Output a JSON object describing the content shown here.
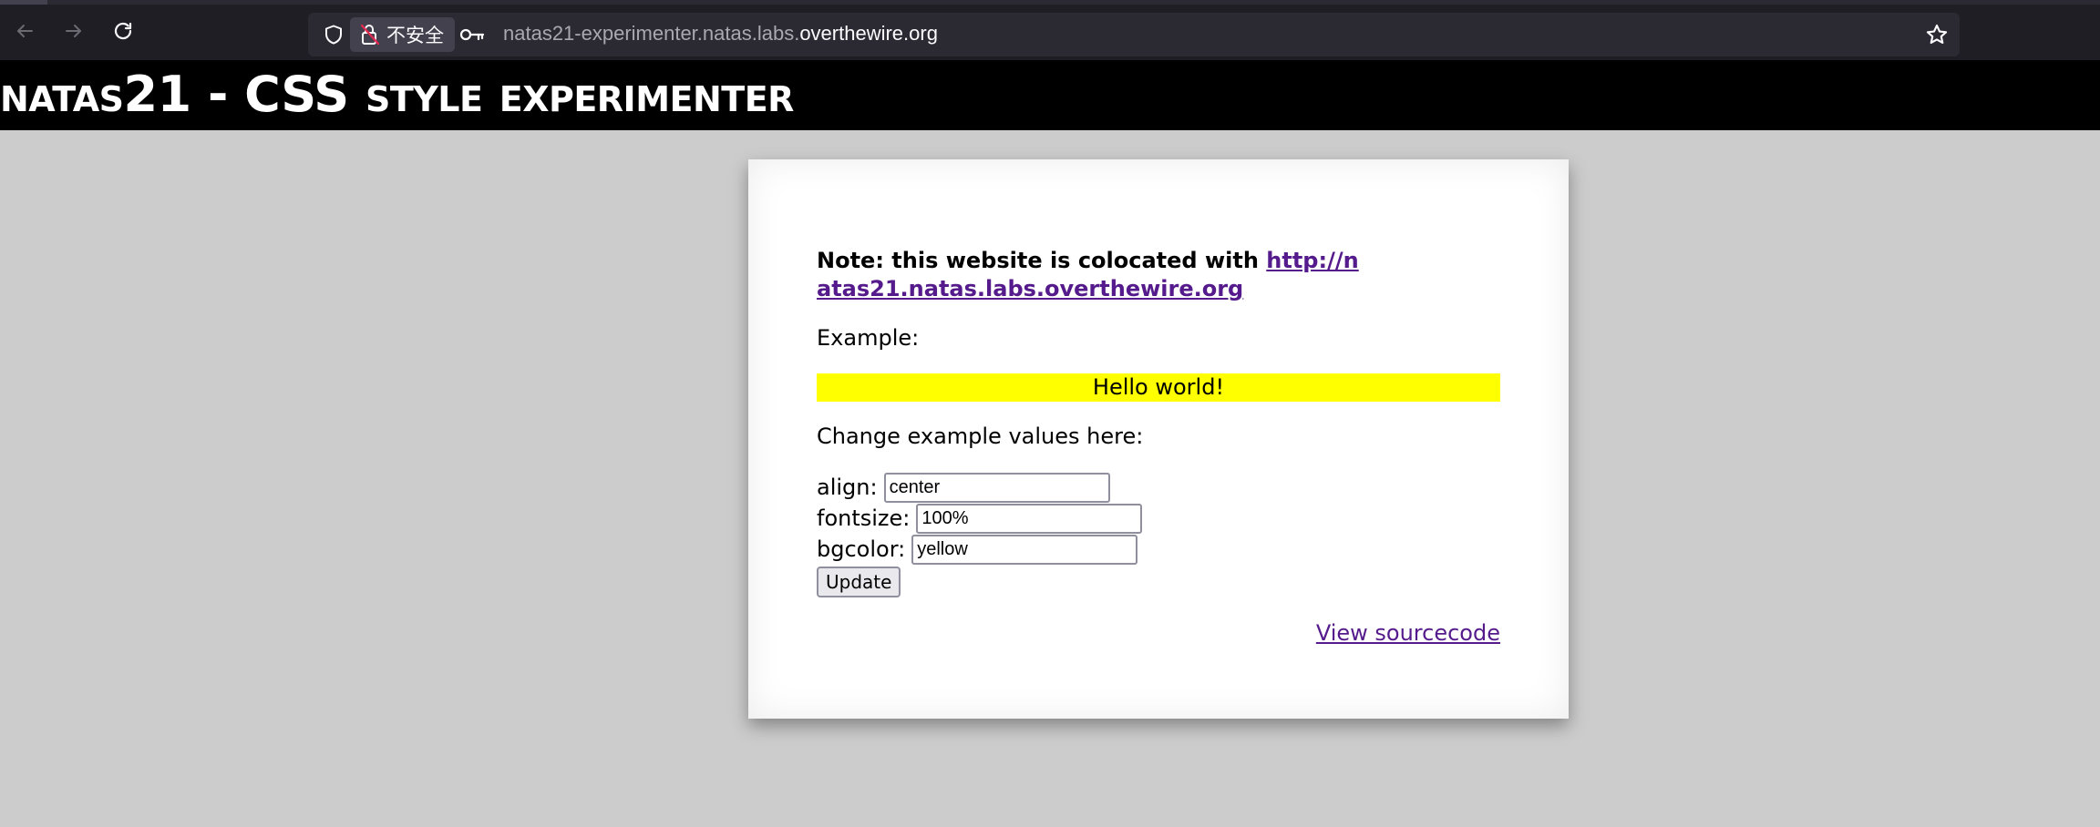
{
  "browser": {
    "security_label": "不安全",
    "url_prefix": "natas21-experimenter.natas.labs.",
    "url_domain": "overthewire.org"
  },
  "page": {
    "title": "natas21 - CSS style experimenter"
  },
  "content": {
    "note_text": "Note: this website is colocated with ",
    "note_link": "http://natas21.natas.labs.overthewire.org",
    "example_label": "Example:",
    "example_text": "Hello world!",
    "change_label": "Change example values here:",
    "fields": [
      {
        "label": "align:",
        "value": "center"
      },
      {
        "label": "fontsize:",
        "value": "100%"
      },
      {
        "label": "bgcolor:",
        "value": "yellow"
      }
    ],
    "update_label": "Update",
    "source_link": "View sourcecode"
  },
  "colors": {
    "header_bg": "#000000",
    "page_bg": "#cccccc",
    "example_bg": "#ffff00",
    "link": "#551a8b"
  }
}
